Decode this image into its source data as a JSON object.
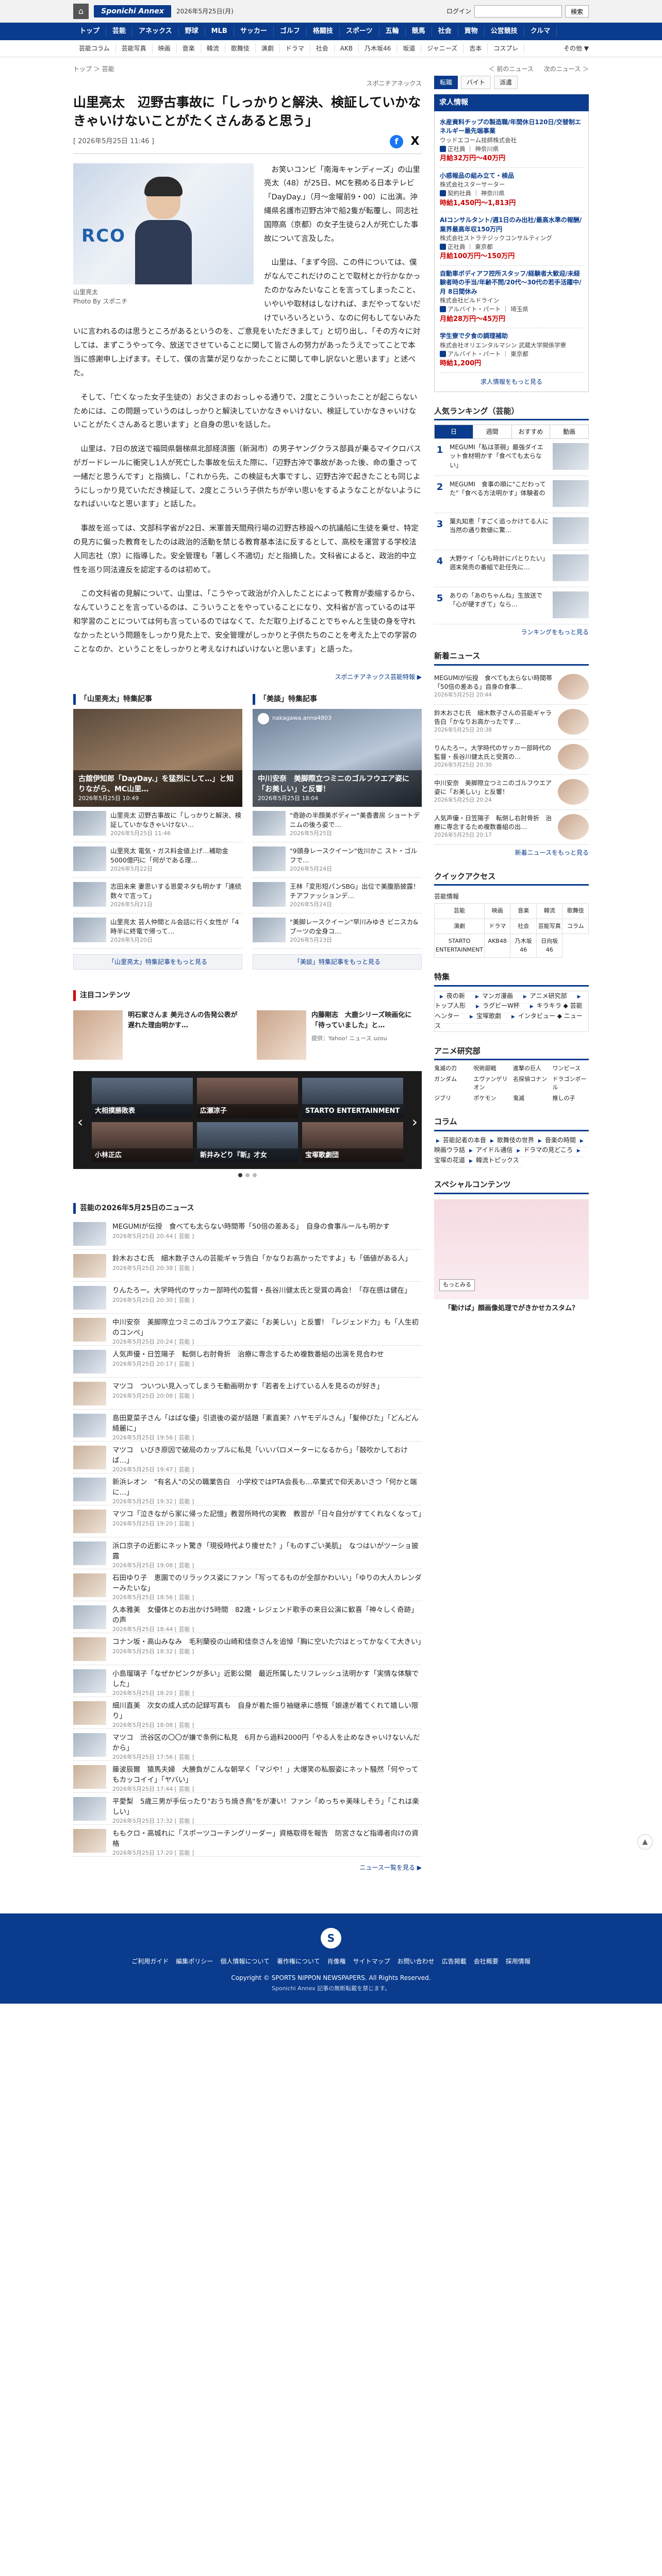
{
  "header": {
    "home_label": "⌂",
    "logo": "Sponichi Annex",
    "date": "2026年5月25日(月)",
    "login": "ログイン",
    "search_placeholder": "",
    "search_btn": "検索"
  },
  "nav": [
    "トップ",
    "芸能",
    "アネックス",
    "野球",
    "MLB",
    "サッカー",
    "ゴルフ",
    "格闘技",
    "スポーツ",
    "五輪",
    "競馬",
    "社会",
    "買物",
    "公営競技",
    "クルマ"
  ],
  "subnav": [
    "芸能コラム",
    "芸能写真",
    "映画",
    "音楽",
    "韓流",
    "歌舞伎",
    "演劇",
    "ドラマ",
    "社会",
    "AKB",
    "乃木坂46",
    "坂道",
    "ジャニーズ",
    "吉本",
    "コスプレ"
  ],
  "subnav_more": "その他 ▼",
  "breadcrumb": "トップ ＞ 芸能",
  "pager_prev": "＜ 前のニュース",
  "pager_next": "次のニュース ＞",
  "source": "スポニチアネックス",
  "article": {
    "title": "山里亮太　辺野古事故に「しっかりと解決、検証していかなきゃいけないことがたくさんあると思う」",
    "date": "[ 2026年5月25日 11:46 ]",
    "photo_caption_name": "山里亮太",
    "photo_caption_credit": "Photo By スポニチ",
    "photo_brand": "RCO",
    "p1": "お笑いコンビ「南海キャンディーズ」の山里亮太（48）が25日、MCを務める日本テレビ「DayDay.」（月～金曜前9・00）に出演。沖縄県名護市辺野古沖で船2隻が転覆し、同志社国際高（京都）の女子生徒ら2人が死亡した事故について言及した。",
    "p2": "山里は、「まず今回、この件については、僕がなんでこれだけのことで取材とか行かなかったのかなみたいなことを言ってしまったこと、いやいや取材はしなければ、まだやってないだけでいろいろという、なのに何もしてないみたいに言われるのは思うところがあるというのを、ご意見をいただきまして」と切り出し、「その方々に対しては、まずこうやって今、放送でさせていることに関して皆さんの努力があったうえでってことで本当に感謝申し上げます。そして、僕の言葉が足りなかったことに関して申し訳ないと思います」と述べた。",
    "p3": "そして、「亡くなった女子生徒の）お父さまのおっしゃる通りで、2度とこういったことが起こらないためには、この問題っていうのはしっかりと解決していかなきゃいけない、検証していかなきゃいけないことがたくさんあると思います」と自身の思いを話した。",
    "p4": "山里は、7日の放送で福岡県磐梯県北部経済圏（新潟市）の男子ヤングクラス部員が乗るマイクロバスがガードレールに衝突し1人が死亡した事故を伝えた際に、「辺野古沖で事故があった後、命の重さって一緒だと思うんです」と指摘し、「これから先、この検証も大事ですし、辺野古沖で起きたことも同じようにしっかり見ていただき検証して、2度とこういう子供たちが辛い思いをするようなことがないようになればいいなと思います」と話した。",
    "p5": "事故を巡っては、文部科学省が22日、米軍普天間飛行場の辺野古移設への抗議船に生徒を乗せ、特定の見方に偏った教育をしたのは政治的活動を禁じる教育基本法に反するとして、高校を運営する学校法人同志社（京）に指導した。安全管理も「著しく不適切」だと指摘した。文科省によると、政治的中立性を巡り同法違反を認定するのは初めて。",
    "p6": "この文科省の見解について、山里は、「こうやって政治が介入したことによって教育が委縮するから、なんていうことを言っているのは、こういうことをやっていることになり、文科省が言っているのは平和学習のことについては何も言っているのではなくて、ただ取り上げることでちゃんと生徒の身を守れなかったという問題をしっかり見た上で、安全管理がしっかりと子供たちのことを考えた上での学習のことなのか、ということをしっかりと考えなければいけないと思います」と語った。",
    "pr": "スポニチアネックス芸能特報 ▶"
  },
  "features": [
    {
      "head": "「山里亮太」特集記事",
      "img_caption": "古舘伊知郎「DayDay.」を猛烈にして…」と知りながら、MC山里…",
      "img_date": "2026年5月25日 10:49",
      "items": [
        {
          "t": "山里亮太 辺野古事故に「しっかりと解決、検証していかなきゃいけない…",
          "d": "2026年5月25日 11:46"
        },
        {
          "t": "山里亮太 電気・ガス料金値上げ…補助金5000億円に「何がである理…",
          "d": "2026年5月22日"
        },
        {
          "t": "志田未来 妻思いする恩愛ネタも明かす「連続数々で言って」",
          "d": "2026年5月21日"
        },
        {
          "t": "山里亮太 芸人仲間とル会話に行く女性が「4時半に終電で帰って…",
          "d": "2026年5月20日"
        }
      ],
      "more": "「山里亮太」特集記事をもっと見る"
    },
    {
      "head": "「美談」特集記事",
      "img_caption": "中川安奈　美脚際立つミニのゴルフウエア姿に「お美しい」と反響！",
      "img_date": "2026年5月25日 18:04",
      "insta": "nakagawa.anna4803",
      "items": [
        {
          "t": "\"奇跡の半顔美ボディー\"美香書房 ショートデニムの後ろ姿で…",
          "d": "2026年5月25日"
        },
        {
          "t": "\"9頭身レースクイーン\"佐川かこ スト・ゴルフで…",
          "d": "2026年5月24日"
        },
        {
          "t": "王林「変形短パンSBG」出位で美腹筋披露！チアファッションデ…",
          "d": "2026年5月24日"
        },
        {
          "t": "\"美脚レースクイーン\"早川みゆき ビニスカ&ブーツの全身コ…",
          "d": "2026年5月23日"
        }
      ],
      "more": "「美談」特集記事をもっと見る"
    }
  ],
  "attention": {
    "head": "注目コンテンツ",
    "items": [
      {
        "t": "明石家さんま 美元さんの告発公表が遅れた理由明かす…",
        "org": ""
      },
      {
        "t": "内藤剛志　大鹿シリーズ映画化に「待っていました」と…",
        "org": "提供：Yahoo! ニュース uzou"
      }
    ]
  },
  "carousel": {
    "cards": [
      {
        "t": "大相撲勝敗表"
      },
      {
        "t": "広瀬凉子"
      },
      {
        "t": "STARTO ENTERTAINMENT"
      },
      {
        "t": "小林正広"
      },
      {
        "t": "新井みどり『新』才女"
      },
      {
        "t": "宝塚歌劇団"
      }
    ],
    "prev": "‹",
    "next": "›"
  },
  "news_head": "芸能の2026年5月25日のニュース",
  "news": [
    {
      "t": "MEGUMIが伝授　食べても太らない時間帯「50倍の差ある」　自身の食事ルールも明かす",
      "d": "2026年5月25日 20:44 [ 芸能 ]"
    },
    {
      "t": "鈴木おさむ氏　細木数子さんの芸能ギャラ告白「かなりお高かったですよ」も「価値がある人」",
      "d": "2026年5月25日 20:38 [ 芸能 ]"
    },
    {
      "t": "りんたろー。大学時代のサッカー部時代の監督・長谷川健太氏と受賞の再会！「存在感は健在」",
      "d": "2026年5月25日 20:30 [ 芸能 ]"
    },
    {
      "t": "中川安奈　美脚際立つミニのゴルフウエア姿に「お美しい」と反響！「レジェンド力」も「人生初のコンペ」",
      "d": "2026年5月25日 20:24 [ 芸能 ]"
    },
    {
      "t": "人気声優・日笠陽子　転倒し右肘骨折　治療に専念するため複数番組の出演を見合わせ",
      "d": "2026年5月25日 20:17 [ 芸能 ]"
    },
    {
      "t": "マツコ　ついつい見入ってしまうモ動画明かす「若者を上げている人を見るのが好き」",
      "d": "2026年5月25日 20:08 [ 芸能 ]"
    },
    {
      "t": "島田夏菜子さん「はばな優」引退後の姿が話題「素直美？ハヤモデルさん」「髪伸びた」「どんどん綺麗に」",
      "d": "2026年5月25日 19:56 [ 芸能 ]"
    },
    {
      "t": "マツコ　いびき原因で破局のカップルに私見「いいパロメーターになるから」「鼓吹かしておけば…」",
      "d": "2026年5月25日 19:47 [ 芸能 ]"
    },
    {
      "t": "新浜レオン　\"有名人\"の父の職業告白　小学校ではPTA会長も…卒業式で仰天あいさつ「何かと端に…」",
      "d": "2026年5月25日 19:32 [ 芸能 ]"
    },
    {
      "t": "マツコ「泣きながら家に帰った記憶」教習所時代の実教　教習が「日々自分がすてくれなくなって」",
      "d": "2026年5月25日 19:20 [ 芸能 ]"
    },
    {
      "t": "浜口京子の近影にネット驚き「現役時代より痩せた？」「ものすごい美肌」　なつはいがツーショ披露",
      "d": "2026年5月25日 19:08 [ 芸能 ]"
    },
    {
      "t": "石田ゆり子　恵園でのリラックス姿にファン「写ってるものが全部かわいい」「ゆりの大人カレンダーみたいな」",
      "d": "2026年5月25日 18:56 [ 芸能 ]"
    },
    {
      "t": "久本雅美　女優体とのお出かけ5時間　82歳・レジェンド歌手の来日公演に歓喜「神々しく奇跡」の声",
      "d": "2026年5月25日 18:44 [ 芸能 ]"
    },
    {
      "t": "コナン坂・高山みなみ　毛利蘭役の山崎和佳奈さんを追悼「胸に空いた穴はとってかなくて大きい」",
      "d": "2026年5月25日 18:32 [ 芸能 ]"
    },
    {
      "t": "小島瑠璃子「なぜかピンクが多い」近影公開　最近所属したリフレッシュ法明かす「実情な体験でした」",
      "d": "2026年5月25日 18:20 [ 芸能 ]"
    },
    {
      "t": "細川直美　次女の成人式の記録写真も　自身が着た振り袖継承に感慨「娘達が着てくれて嬉しい限り」",
      "d": "2026年5月25日 18:08 [ 芸能 ]"
    },
    {
      "t": "マツコ　渋谷区の〇〇が嫌で条例に私見　6月から過料2000円「やる人を止めなきゃいけないんだから」",
      "d": "2026年5月25日 17:56 [ 芸能 ]"
    },
    {
      "t": "藤波辰爾　猿馬夫婦　大勝負がこんな朝早く「マジや！」大爆笑の私服姿にネット騒然「何やってもカッコイイ」「ヤバい」",
      "d": "2026年5月25日 17:44 [ 芸能 ]"
    },
    {
      "t": "平愛梨　5歳三男が手伝ったり\"おうち焼き鳥\"をが凄い！ファン「めっちゃ美味しそう」「これは楽しい」",
      "d": "2026年5月25日 17:32 [ 芸能 ]"
    },
    {
      "t": "ももクロ・高城れに「スポーツコーチングリーダー」資格取得を報告　防宮さなど指導者向けの資格",
      "d": "2026年5月25日 17:20 [ 芸能 ]"
    }
  ],
  "news_more": "ニュース一覧を見る ▶",
  "side": {
    "tabs": [
      "転職",
      "バイト",
      "派遣"
    ],
    "job_head": "求人情報",
    "jobs": [
      {
        "co": "水産資料チップの製造職/年間休日120日/交替制エネルギー最先端事業",
        "l1": "ウッドエコーム技師株式会社",
        "l2": "正社員 ｜ 神奈川県",
        "sal": "月給32万円〜40万円"
      },
      {
        "co": "小惑報品の組み立て・検品",
        "l1": "株式会社スターサーター",
        "l2": "契約社員 ｜ 神奈川県",
        "sal": "時給1,450円〜1,813円"
      },
      {
        "co": "AIコンサルタント/週1日のみ出社/最高水準の報酬/業界最高年収150万円",
        "l1": "株式会社ストラテジックコンサルティング",
        "l2": "正社員 ｜ 東京都",
        "sal": "月給100万円〜150万円"
      },
      {
        "co": "自動車ボディアフ控所スタッフ/経験者大歓迎/未経験者時の手当/年齢不問/20代〜30代の若手活躍中/月 8日間休み",
        "l1": "株式会社ビルドライン",
        "l2": "アルバイト・パート ｜ 埼玉県",
        "sal": "月給28万円〜45万円"
      },
      {
        "co": "学生寮で夕食の調理補助",
        "l1": "株式会社オリエンタルマシン 武蔵大学関係学寮",
        "l2": "アルバイト・パート ｜ 東京都",
        "sal": "時給1,200円"
      }
    ],
    "job_more": "求人情報をもっと見る",
    "rank_title": "人気ランキング（芸能）",
    "rank_tabs": [
      "日",
      "週間",
      "おすすめ",
      "動画"
    ],
    "ranks": [
      {
        "no": "1",
        "t": "MEGUMI「私は茶碗」最強ダイエット食材明かす「食べても太らない」"
      },
      {
        "no": "2",
        "t": "MEGUMI　食事の順に\"こだわってた\"「食べる方法明かす」体験者の"
      },
      {
        "no": "3",
        "t": "葉丸知恵「すごく追っかけてる人に当然の通り数値に驚…"
      },
      {
        "no": "4",
        "t": "大野ケイ「心も時計にパとりたい」週末発売の番組で赴任先に…"
      },
      {
        "no": "5",
        "t": "ありの「あのちゃんね」生放送で「心が硬すぎて」なら…"
      }
    ],
    "rank_more": "ランキングをもっと見る",
    "latest_title": "新着ニュース",
    "latest": [
      {
        "t": "MEGUMIが伝授　食べても太らない時間帯「50倍の差ある」自身の食事…",
        "d": "2026年5月25日 20:44"
      },
      {
        "t": "鈴木おさむ氏　細木数子さんの芸能ギャラ告白「かなりお高かったです…",
        "d": "2026年5月25日 20:38"
      },
      {
        "t": "りんたろー。大学時代のサッカー部時代の監督・長谷川健太氏と受賞の…",
        "d": "2026年5月25日 20:30"
      },
      {
        "t": "中川安奈　美脚際立つミニのゴルフウエア姿に「お美しい」と反響！",
        "d": "2026年5月25日 20:24"
      },
      {
        "t": "人気声優・日笠陽子　転倒し右肘骨折　治療に専念するため複数番組の出…",
        "d": "2026年5月25日 20:17"
      }
    ],
    "latest_more": "新着ニュースをもっと見る",
    "quick_title": "クイックアクセス",
    "quick_head": "芸能情報",
    "quick": [
      "芸能",
      "映画",
      "音楽",
      "韓流",
      "歌舞伎",
      "演劇",
      "ドラマ",
      "社会",
      "芸能写真",
      "コラム",
      "STARTO ENTERTAINMENT",
      "AKB48",
      "乃木坂46",
      "日向坂46"
    ],
    "toku_title": "特集",
    "toku": [
      "夜の新",
      "マンガ漫画",
      "アニメ研究部",
      "トップ人形",
      "ラグビーW杯",
      "キラキラ ◆ 芸能ヘンター",
      "宝塚歌劇",
      "インタビュー ◆ ニュース"
    ],
    "anime_title": "アニメ研究部",
    "anime": [
      "鬼滅の刃",
      "呪術廻戦",
      "進撃の巨人",
      "ワンピース",
      "ガンダム",
      "エヴァンゲリオン",
      "名探偵コナン",
      "ドラゴンボール",
      "ジブリ",
      "ポケモン",
      "鬼滅",
      "推しの子"
    ],
    "column_title": "コラム",
    "columns": [
      "芸能記者の本音",
      "歌舞伎の世界",
      "音楽の時間",
      "映画ウラ話",
      "アイドル通信",
      "ドラマの見どころ",
      "宝塚の花道",
      "韓流トピックス"
    ],
    "special_title": "スペシャルコンテンツ",
    "special_text": "「動けば」顔画像処理でがきかせカスタム？",
    "special_btn": "もっとみる"
  },
  "page_top": "▲",
  "footer": {
    "logo": "S",
    "links": [
      "ご利用ガイド",
      "編集ポリシー",
      "個人情報について",
      "著作権について",
      "肖像権",
      "サイトマップ",
      "お問い合わせ",
      "広告掲載",
      "会社概要",
      "採用情報"
    ],
    "copyright": "Copyright © SPORTS NIPPON NEWSPAPERS. All Rights Reserved.",
    "note": "Sponichi Annex 記事の無断転載を禁じます。"
  }
}
